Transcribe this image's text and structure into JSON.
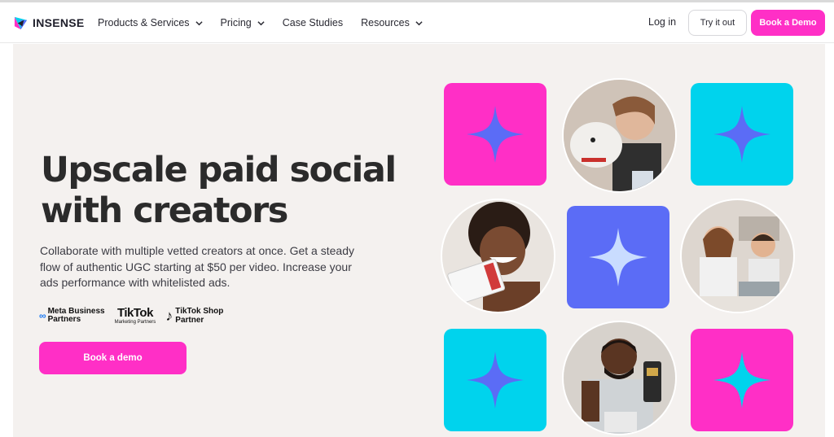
{
  "brand": {
    "name": "INSENSE",
    "accent": "#ff2fc6",
    "cyan": "#00d3ed",
    "blue": "#5b6cf6"
  },
  "nav": {
    "items": [
      {
        "label": "Products & Services",
        "has_dropdown": true
      },
      {
        "label": "Pricing",
        "has_dropdown": true
      },
      {
        "label": "Case Studies",
        "has_dropdown": false
      },
      {
        "label": "Resources",
        "has_dropdown": true
      }
    ],
    "login": "Log in",
    "try_it_out": "Try it out",
    "book_demo": "Book a Demo"
  },
  "hero": {
    "title_line1": "Upscale paid social",
    "title_line2": "with creators",
    "subtitle": "Collaborate with multiple vetted creators at once. Get a steady flow of authentic UGC starting at $50 per video. Increase your ads performance with whitelisted ads.",
    "partners": {
      "meta_line1": "Meta Business",
      "meta_line2": "Partners",
      "tiktok_big": "TikTok",
      "tiktok_small": "Marketing Partners",
      "tts_line1": "TikTok Shop",
      "tts_line2": "Partner"
    },
    "cta": "Book a demo"
  },
  "grid": {
    "tiles": [
      {
        "kind": "star-tile",
        "bg": "#ff2fc6",
        "star": "#5b6cf6"
      },
      {
        "kind": "photo",
        "subject": "woman-with-dog"
      },
      {
        "kind": "star-tile",
        "bg": "#00d3ed",
        "star": "#5b6cf6"
      },
      {
        "kind": "photo",
        "subject": "smiling-woman-with-card"
      },
      {
        "kind": "star-tile",
        "bg": "#5b6cf6",
        "star": "#c9dcff"
      },
      {
        "kind": "photo",
        "subject": "kids-cooking"
      },
      {
        "kind": "star-tile",
        "bg": "#00d3ed",
        "star": "#5b6cf6"
      },
      {
        "kind": "photo",
        "subject": "man-with-product"
      },
      {
        "kind": "star-tile",
        "bg": "#ff2fc6",
        "star": "#00d3ed"
      }
    ]
  }
}
